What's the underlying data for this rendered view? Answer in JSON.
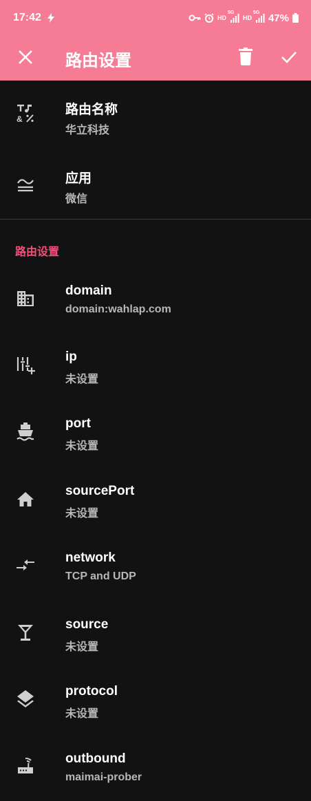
{
  "status_bar": {
    "time": "17:42",
    "net_hd1": "HD",
    "net_5g1": "5G",
    "net_hd2": "HD",
    "net_5g2": "5G",
    "battery_percent": "47%"
  },
  "app_bar": {
    "title": "路由设置"
  },
  "basic": [
    {
      "label": "路由名称",
      "value": "华立科技",
      "icon": "text-format-icon"
    },
    {
      "label": "应用",
      "value": "微信",
      "icon": "waves-icon"
    }
  ],
  "section": {
    "title": "路由设置"
  },
  "rules": [
    {
      "label": "domain",
      "value": "domain:wahlap.com",
      "icon": "domain-icon"
    },
    {
      "label": "ip",
      "value": "未设置",
      "icon": "sliders-add-icon"
    },
    {
      "label": "port",
      "value": "未设置",
      "icon": "ship-icon"
    },
    {
      "label": "sourcePort",
      "value": "未设置",
      "icon": "home-icon"
    },
    {
      "label": "network",
      "value": "TCP and UDP",
      "icon": "compare-arrows-icon"
    },
    {
      "label": "source",
      "value": "未设置",
      "icon": "cocktail-icon"
    },
    {
      "label": "protocol",
      "value": "未设置",
      "icon": "layers-icon"
    },
    {
      "label": "outbound",
      "value": "maimai-prober",
      "icon": "router-icon"
    }
  ],
  "colors": {
    "app_bar": "#f57c94",
    "background": "#121212",
    "accent": "#f2507c",
    "secondary_text": "#b7b7b7",
    "icon": "#cfcfcf"
  }
}
